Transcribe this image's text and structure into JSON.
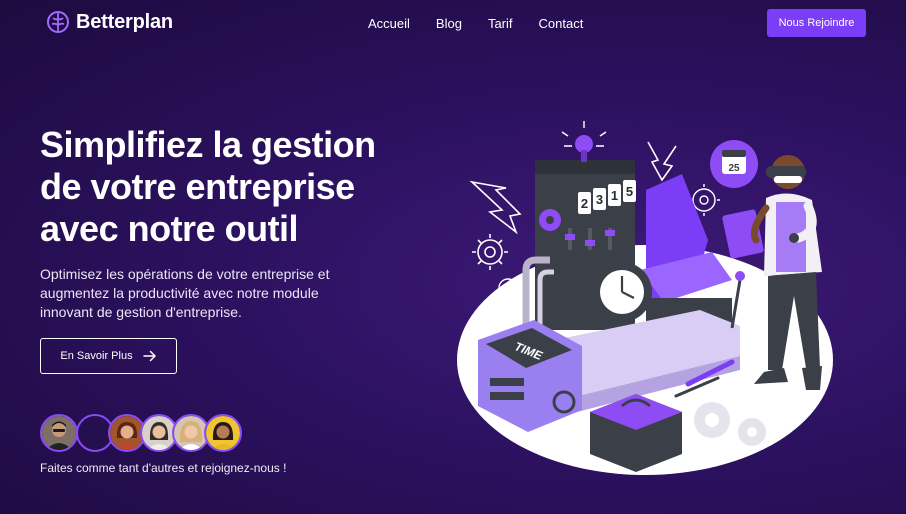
{
  "brand": {
    "name": "Betterplan",
    "logo_icon": "brain-icon",
    "accent": "#7b3df5"
  },
  "nav": {
    "links": [
      "Accueil",
      "Blog",
      "Tarif",
      "Contact"
    ],
    "cta_label": "Nous Rejoindre"
  },
  "hero": {
    "title_lines": [
      "Simplifiez la gestion",
      "de votre entreprise",
      "avec notre outil"
    ],
    "subtitle_lines": [
      "Optimisez les opérations de votre entreprise et",
      "augmentez la productivité avec notre module",
      "innovant de gestion d'entreprise."
    ],
    "button_label": "En Savoir Plus",
    "button_icon": "arrow-right-icon"
  },
  "community": {
    "caption": "Faites comme tant d'autres et rejoignez-nous !"
  },
  "illustration": {
    "counter_digits": [
      "2",
      "3",
      "1",
      "5"
    ],
    "time_label": "TIME",
    "calendar_day": "25"
  }
}
